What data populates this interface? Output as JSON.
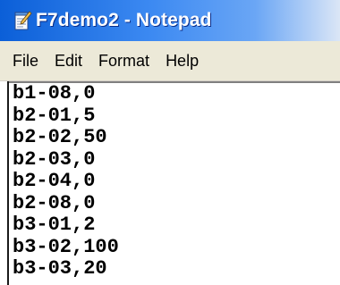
{
  "window": {
    "title": "F7demo2 - Notepad",
    "app_icon": "notepad-icon"
  },
  "menubar": {
    "items": [
      "File",
      "Edit",
      "Format",
      "Help"
    ]
  },
  "editor": {
    "lines": [
      "b1-08,0",
      "b2-01,5",
      "b2-02,50",
      "b2-03,0",
      "b2-04,0",
      "b2-08,0",
      "b3-01,2",
      "b3-02,100",
      "b3-03,20"
    ]
  },
  "colors": {
    "titlebar_start": "#0b5fd8",
    "titlebar_end": "#dbe6f6",
    "menubar_bg": "#ece9d8",
    "text": "#000000"
  }
}
